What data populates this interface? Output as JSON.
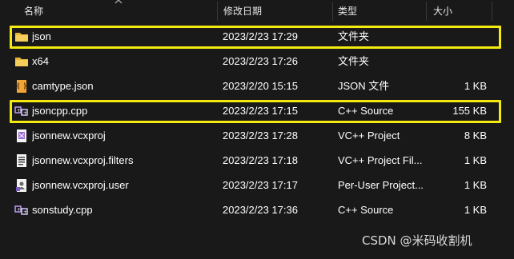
{
  "header": {
    "name": "名称",
    "date": "修改日期",
    "type": "类型",
    "size": "大小"
  },
  "files": [
    {
      "name": "json",
      "date": "2023/2/23 17:29",
      "type": "文件夹",
      "size": "",
      "icon": "folder-icon",
      "highlighted": true
    },
    {
      "name": "x64",
      "date": "2023/2/23 17:26",
      "type": "文件夹",
      "size": "",
      "icon": "folder-icon",
      "highlighted": false
    },
    {
      "name": "camtype.json",
      "date": "2023/2/20 15:15",
      "type": "JSON 文件",
      "size": "1 KB",
      "icon": "json-file-icon",
      "highlighted": false
    },
    {
      "name": "jsoncpp.cpp",
      "date": "2023/2/23 17:15",
      "type": "C++ Source",
      "size": "155 KB",
      "icon": "cpp-file-icon",
      "highlighted": true
    },
    {
      "name": "jsonnew.vcxproj",
      "date": "2023/2/23 17:28",
      "type": "VC++ Project",
      "size": "8 KB",
      "icon": "vcxproj-file-icon",
      "highlighted": false
    },
    {
      "name": "jsonnew.vcxproj.filters",
      "date": "2023/2/23 17:18",
      "type": "VC++ Project Fil...",
      "size": "1 KB",
      "icon": "filters-file-icon",
      "highlighted": false
    },
    {
      "name": "jsonnew.vcxproj.user",
      "date": "2023/2/23 17:17",
      "type": "Per-User Project...",
      "size": "1 KB",
      "icon": "user-file-icon",
      "highlighted": false
    },
    {
      "name": "sonstudy.cpp",
      "date": "2023/2/23 17:36",
      "type": "C++ Source",
      "size": "1 KB",
      "icon": "cpp-file-icon",
      "highlighted": false
    }
  ],
  "watermark": "CSDN @米码收割机",
  "colors": {
    "background": "#191919",
    "highlight": "#f5ea10",
    "folder": "#f0c048"
  }
}
